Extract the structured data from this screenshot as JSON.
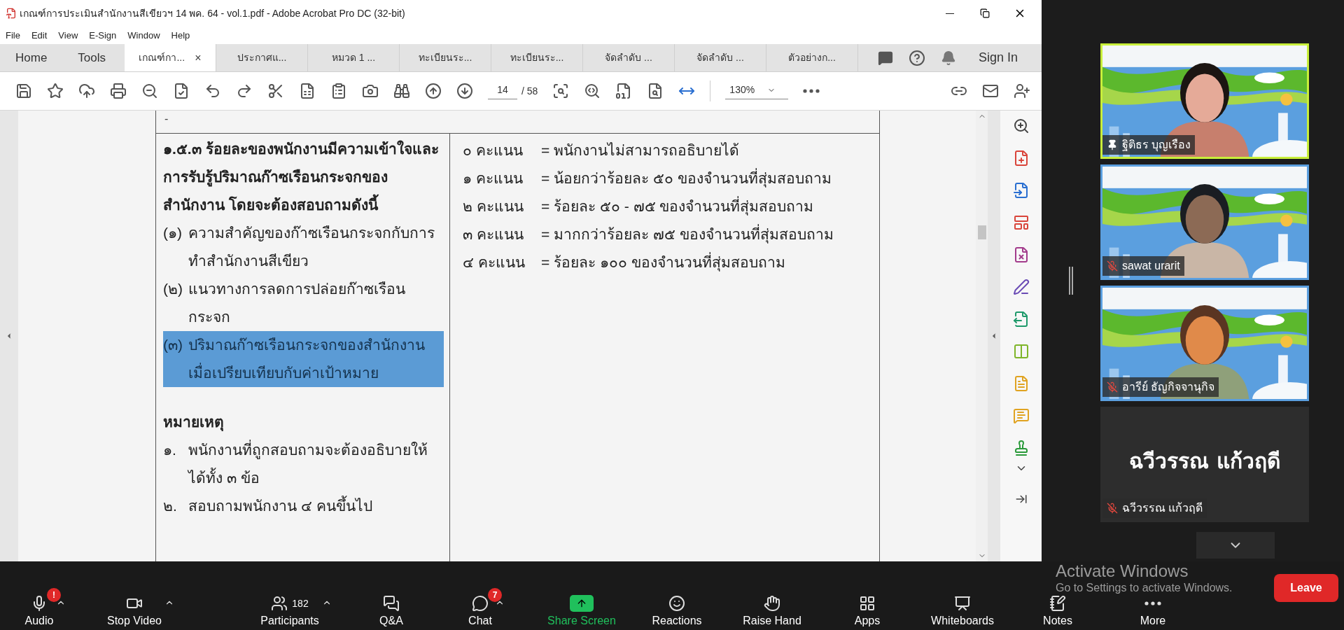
{
  "window": {
    "title": "เกณฑ์การประเมินสำนักงานสีเขียวฯ 14 พค. 64 - vol.1.pdf - Adobe Acrobat Pro DC (32-bit)"
  },
  "menu": [
    "File",
    "Edit",
    "View",
    "E-Sign",
    "Window",
    "Help"
  ],
  "nav": [
    "Home",
    "Tools"
  ],
  "tabs": [
    {
      "label": "เกณฑ์กา...",
      "selected": true
    },
    {
      "label": "ประกาศแ...",
      "selected": false
    },
    {
      "label": "หมวด 1 ...",
      "selected": false
    },
    {
      "label": "ทะเบียนระ...",
      "selected": false
    },
    {
      "label": "ทะเบียนระ...",
      "selected": false
    },
    {
      "label": "จัดลำดับ ...",
      "selected": false
    },
    {
      "label": "จัดลำดับ ...",
      "selected": false
    },
    {
      "label": "ตัวอย่างก...",
      "selected": false
    }
  ],
  "tab_close": "×",
  "sign_in": "Sign In",
  "toolbar": {
    "page": "14",
    "page_total": "/ 58",
    "zoom": "130%"
  },
  "document": {
    "top_mark": "-",
    "heading": "๑.๕.๓ ร้อยละของพนักงานมีความเข้าใจและการรับรู้ปริมาณก๊าซเรือนกระจกของสำนักงาน โดยจะต้องสอบถามดังนี้",
    "items": [
      {
        "number": "(๑)",
        "text": "ความสำคัญของก๊าซเรือนกระจกกับการทำสำนักงานสีเขียว",
        "selected": false
      },
      {
        "number": "(๒)",
        "text": "แนวทางการลดการปล่อยก๊าซเรือนกระจก",
        "selected": false
      },
      {
        "number": "(๓)",
        "text": "ปริมาณก๊าซเรือนกระจกของสำนักงานเมื่อเปรียบเทียบกับค่าเป้าหมาย",
        "selected": true
      }
    ],
    "note_title": "หมายเหตุ",
    "notes": [
      {
        "number": "๑.",
        "text": "พนักงานที่ถูกสอบถามจะต้องอธิบายให้ได้ทั้ง ๓ ข้อ"
      },
      {
        "number": "๒.",
        "text": "สอบถามพนักงาน ๔ คนขึ้นไป"
      }
    ],
    "scores": [
      {
        "points": "๐ คะแนน",
        "desc": "= พนักงานไม่สามารถอธิบายได้"
      },
      {
        "points": "๑ คะแนน",
        "desc": "= น้อยกว่าร้อยละ ๕๐ ของจำนวนที่สุ่มสอบถาม"
      },
      {
        "points": "๒ คะแนน",
        "desc": "= ร้อยละ ๕๐ - ๗๕ ของจำนวนที่สุ่มสอบถาม"
      },
      {
        "points": "๓ คะแนน",
        "desc": "= มากกว่าร้อยละ ๗๕ ของจำนวนที่สุ่มสอบถาม"
      },
      {
        "points": "๔ คะแนน",
        "desc": "= ร้อยละ ๑๐๐ ของจำนวนที่สุ่มสอบถาม"
      }
    ]
  },
  "participants": [
    {
      "kind": "video",
      "name": "ฐิติธร บุญเรือง",
      "speaking": true,
      "pinned": true,
      "muted": false
    },
    {
      "kind": "video",
      "name": "sawat urarit",
      "speaking": false,
      "pinned": false,
      "muted": true
    },
    {
      "kind": "video",
      "name": "อารีย์ ธัญกิจจานุกิจ",
      "speaking": false,
      "pinned": false,
      "muted": true
    },
    {
      "kind": "name",
      "display_name": "ฉวีวรรณ  แก้วฤดี",
      "name": "ฉวีวรรณ  แก้วฤดี",
      "speaking": false,
      "pinned": false,
      "muted": true
    }
  ],
  "meeting_bar": [
    {
      "label": "Audio",
      "badge": "!",
      "caret": true
    },
    {
      "label": "Stop Video",
      "caret": true
    },
    {
      "label": "Participants",
      "count": "182",
      "caret": true
    },
    {
      "label": "Q&A",
      "caret": false
    },
    {
      "label": "Chat",
      "badge": "7",
      "caret": true
    },
    {
      "label": "Share Screen",
      "caret": false
    },
    {
      "label": "Reactions",
      "caret": false
    },
    {
      "label": "Raise Hand",
      "caret": false
    },
    {
      "label": "Apps",
      "caret": false
    },
    {
      "label": "Whiteboards",
      "caret": false
    },
    {
      "label": "Notes",
      "caret": false
    },
    {
      "label": "More",
      "caret": false
    }
  ],
  "leave": "Leave",
  "activation": {
    "title": "Activate Windows",
    "subtitle": "Go to Settings to activate Windows."
  }
}
